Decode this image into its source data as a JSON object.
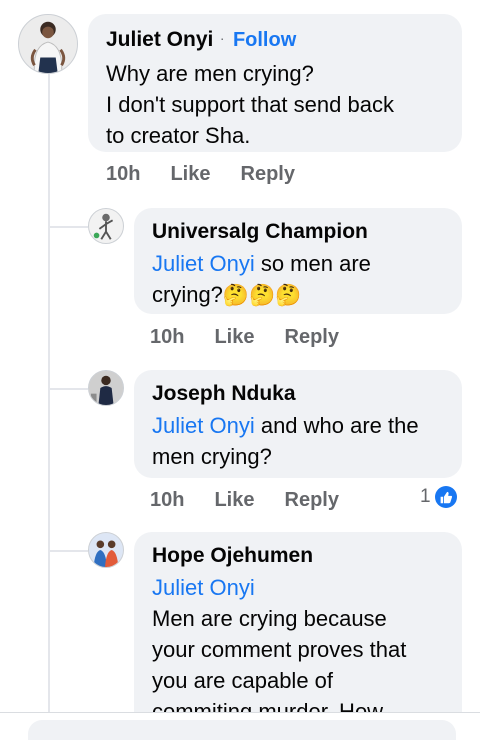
{
  "comments": [
    {
      "author": "Juliet Onyi",
      "follow_label": "Follow",
      "separator": "·",
      "text_lines": [
        "Why are men crying?",
        "I don't support that send back",
        "to creator Sha."
      ],
      "time": "10h",
      "like_label": "Like",
      "reply_label": "Reply",
      "avatar_icon": "woman-profile-photo"
    }
  ],
  "replies": [
    {
      "author": "Universalg Champion",
      "mention": "Juliet Onyi",
      "line1_rest": " so men are",
      "line2": "crying?",
      "emojis": "🤔🤔🤔",
      "time": "10h",
      "like_label": "Like",
      "reply_label": "Reply",
      "avatar_icon": "sketch-figure-avatar"
    },
    {
      "author": "Joseph Nduka",
      "mention": "Juliet Onyi",
      "line1_rest": " and who are the",
      "line2": "men crying?",
      "time": "10h",
      "like_label": "Like",
      "reply_label": "Reply",
      "reaction_count": "1",
      "reaction_icon": "thumbs-up-icon",
      "avatar_icon": "man-profile-photo"
    },
    {
      "author": "Hope Ojehumen",
      "mention": "Juliet Onyi",
      "lines": [
        "Men are crying because",
        "your comment proves that",
        "you are capable of",
        "commiting murder. How"
      ],
      "avatar_icon": "group-profile-photo"
    }
  ],
  "colors": {
    "link": "#1877f2",
    "bubble": "#f0f2f5",
    "meta": "#65676b",
    "thread_line": "#e4e6eb"
  }
}
